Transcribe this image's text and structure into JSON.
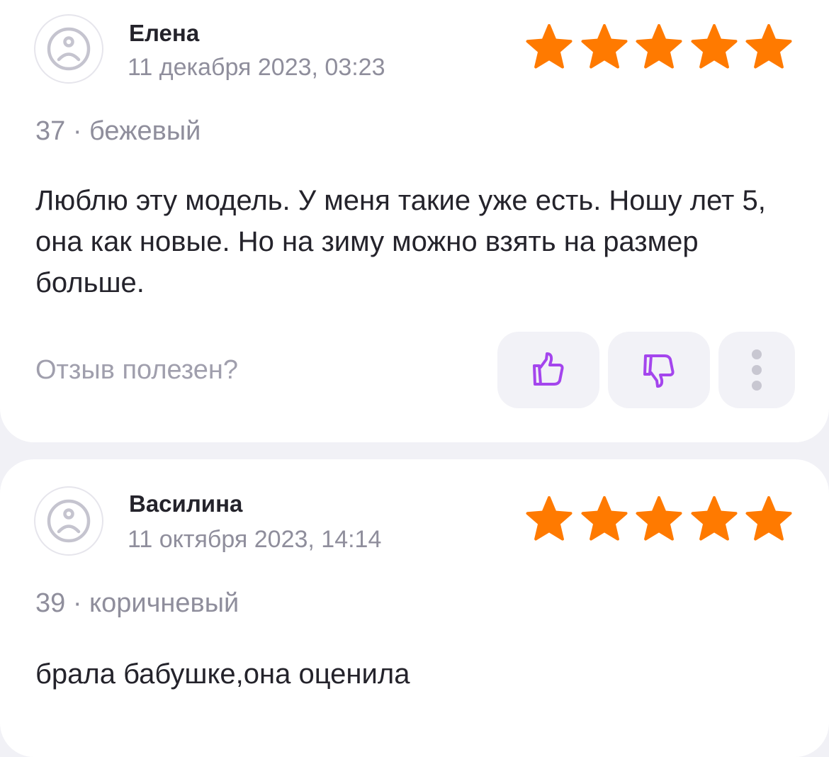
{
  "accent_star_color": "#ff7a00",
  "accent_icon_color": "#a445ed",
  "reviews": [
    {
      "author": "Елена",
      "date": "11 декабря 2023, 03:23",
      "rating": 5,
      "variant": "37 · бежевый",
      "text": "Люблю эту модель. У меня такие уже есть. Ношу лет 5, она как новые. Но на зиму можно взять на размер  больше.",
      "helpful_label": "Отзыв полезен?",
      "icons": {
        "avatar": "sad-face-icon",
        "like": "thumbs-up-icon",
        "dislike": "thumbs-down-icon",
        "more": "more-vertical-icon"
      }
    },
    {
      "author": "Василина",
      "date": "11 октября 2023, 14:14",
      "rating": 5,
      "variant": "39 · коричневый",
      "text": "брала бабушке,она оценила",
      "icons": {
        "avatar": "sad-face-icon"
      }
    }
  ]
}
